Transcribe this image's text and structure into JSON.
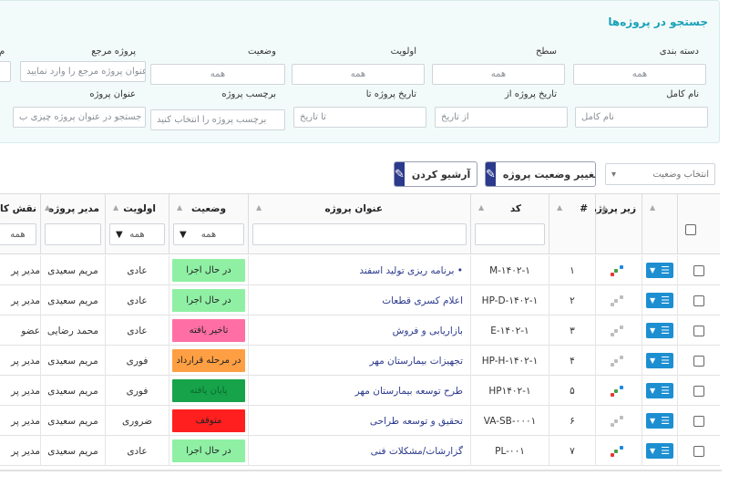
{
  "search": {
    "title": "جستجو در پروژه‌ها",
    "fields": {
      "category": {
        "label": "دسته بندی",
        "value": "همه"
      },
      "level": {
        "label": "سطح",
        "value": "همه"
      },
      "priority": {
        "label": "اولویت",
        "value": "همه"
      },
      "status": {
        "label": "وضعیت",
        "value": "همه"
      },
      "ref_project": {
        "label": "پروژه مرجع",
        "placeholder": "عنوان پروژه مرجع را وارد نمایید"
      },
      "cut_label": {
        "label": "م"
      },
      "full_name": {
        "label": "نام کامل",
        "placeholder": "نام کامل"
      },
      "date_from": {
        "label": "تاریخ پروژه از",
        "placeholder": "از تاریخ"
      },
      "date_to": {
        "label": "تاریخ پروژه تا",
        "placeholder": "تا تاریخ"
      },
      "tag": {
        "label": "برچسب پروژه",
        "placeholder": "برچسب پروژه را انتخاب کنید"
      },
      "project_title": {
        "label": "عنوان پروژه",
        "placeholder": "برای جستجو در عنوان پروژه چیزی ب"
      }
    }
  },
  "toolbar": {
    "status_select": "انتخاب وضعیت",
    "change_status": "تغییر وضعیت پروژه",
    "archive": "آرشیو کردن"
  },
  "table": {
    "headers": {
      "subproject": "زیر پروژه",
      "index": "#",
      "code": "کد",
      "title": "عنوان پروژه",
      "status": "وضعیت",
      "priority": "اولویت",
      "manager": "مدیر پروژه",
      "role": "نقش کا"
    },
    "filters": {
      "status": "همه",
      "priority": "همه",
      "role": "همه"
    },
    "rows": [
      {
        "index": "۱",
        "code": "M-۱۴۰۲-۱",
        "title": "• برنامه ریزی تولید اسفند",
        "status": "در حال اجرا",
        "status_color": "#8ff0a4",
        "status_text_color": "#222222",
        "priority": "عادی",
        "manager": "مریم سعیدی",
        "role": "مدیر پر",
        "sub_active": true
      },
      {
        "index": "۲",
        "code": "HP-D-۱۴۰۲-۱",
        "title": "اعلام کسری قطعات",
        "status": "در حال اجرا",
        "status_color": "#8ff0a4",
        "status_text_color": "#222222",
        "priority": "عادی",
        "manager": "مریم سعیدی",
        "role": "مدیر پر",
        "sub_active": false
      },
      {
        "index": "۳",
        "code": "E-۱۴۰۲-۱",
        "title": "بازاریابی و فروش",
        "status": "تاخیر یافته",
        "status_color": "#ff6fa5",
        "status_text_color": "#222222",
        "priority": "عادی",
        "manager": "محمد رضایی",
        "role": "عضو",
        "sub_active": false
      },
      {
        "index": "۴",
        "code": "HP-H-۱۴۰۲-۱",
        "title": "تجهیزات بیمارستان مهر",
        "status": "در مرحله قرارداد",
        "status_color": "#ff9f43",
        "status_text_color": "#222222",
        "priority": "فوری",
        "manager": "مریم سعیدی",
        "role": "مدیر پر",
        "sub_active": false
      },
      {
        "index": "۵",
        "code": "HP۱۴۰۲-۱",
        "title": "طرح توسعه بیمارستان مهر",
        "status": "پایان یافته",
        "status_color": "#16a34a",
        "status_text_color": "#0d6b2c",
        "priority": "فوری",
        "manager": "مریم سعیدی",
        "role": "مدیر پر",
        "sub_active": true
      },
      {
        "index": "۶",
        "code": "VA-SB-۰۰۰۱",
        "title": "تحقیق و توسعه طراحی",
        "status": "متوقف",
        "status_color": "#ff1f1f",
        "status_text_color": "#222222",
        "priority": "ضروری",
        "manager": "مریم سعیدی",
        "role": "مدیر پر",
        "sub_active": false
      },
      {
        "index": "۷",
        "code": "PL-۰۰۱",
        "title": "گزارشات/مشکلات فنی",
        "status": "در حال اجرا",
        "status_color": "#8ff0a4",
        "status_text_color": "#222222",
        "priority": "عادی",
        "manager": "مریم سعیدی",
        "role": "مدیر پر",
        "sub_active": true
      }
    ]
  },
  "colors": {
    "accent": "#17a2b8",
    "primary_dark": "#2c3a8c",
    "menu_blue": "#1d8fd1"
  },
  "icons": {
    "edit": "pencil-icon",
    "menu": "hamburger-icon",
    "subproject": "subproject-icon",
    "dropdown": "chevron-down-icon"
  }
}
